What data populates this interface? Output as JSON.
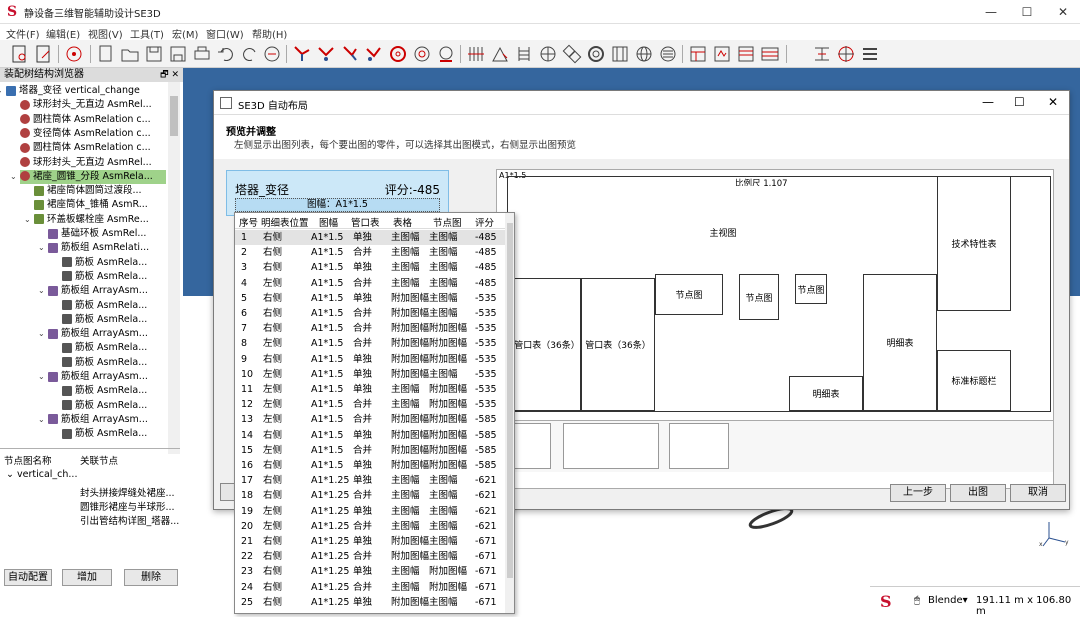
{
  "app": {
    "title": "静设备三维智能辅助设计SE3D"
  },
  "menu": [
    "文件(F)",
    "编辑(E)",
    "视图(V)",
    "工具(T)",
    "宏(M)",
    "窗口(W)",
    "帮助(H)"
  ],
  "tree_panel": {
    "title": "装配树结构浏览器",
    "items": [
      {
        "label": "塔器_变径 vertical_change",
        "level": 0
      },
      {
        "label": "球形封头_无直边 AsmRel...",
        "level": 1
      },
      {
        "label": "圆柱筒体 AsmRelation c...",
        "level": 1
      },
      {
        "label": "变径筒体 AsmRelation c...",
        "level": 1
      },
      {
        "label": "圆柱筒体 AsmRelation c...",
        "level": 1
      },
      {
        "label": "球形封头_无直边 AsmRel...",
        "level": 1
      },
      {
        "label": "裙座_圆锥_分段 AsmRela...",
        "level": 1
      },
      {
        "label": "裙座筒体圆筒过渡段...",
        "level": 2
      },
      {
        "label": "裙座筒体_锥桶 AsmR...",
        "level": 2
      },
      {
        "label": "环盖板螺栓座 AsmRe...",
        "level": 2
      },
      {
        "label": "基础环板 AsmRel...",
        "level": 3
      },
      {
        "label": "筋板组 AsmRelati...",
        "level": 3
      },
      {
        "label": "筋板 AsmRela...",
        "level": 4
      },
      {
        "label": "筋板 AsmRela...",
        "level": 4
      },
      {
        "label": "筋板组 ArrayAsm...",
        "level": 3
      },
      {
        "label": "筋板 AsmRela...",
        "level": 4
      },
      {
        "label": "筋板 AsmRela...",
        "level": 4
      },
      {
        "label": "筋板组 ArrayAsm...",
        "level": 3
      },
      {
        "label": "筋板 AsmRela...",
        "level": 4
      },
      {
        "label": "筋板 AsmRela...",
        "level": 4
      },
      {
        "label": "筋板组 ArrayAsm...",
        "level": 3
      },
      {
        "label": "筋板 AsmRela...",
        "level": 4
      },
      {
        "label": "筋板 AsmRela...",
        "level": 4
      },
      {
        "label": "筋板组 ArrayAsm...",
        "level": 3
      },
      {
        "label": "筋板 AsmRela...",
        "level": 4
      }
    ]
  },
  "node_panel": {
    "col1": "节点图名称",
    "col2": "关联节点",
    "root": "vertical_ch...",
    "children": [
      "封头拼接焊缝处裙座...",
      "圆锥形裙座与半球形...",
      "引出管结构详图_塔器..."
    ],
    "buttons": [
      "自动配置",
      "增加",
      "删除"
    ]
  },
  "dialog": {
    "title": "SE3D 自动布局",
    "heading": "预览并调整",
    "subtext": "左侧显示出图列表，每个要出图的零件，可以选择其出图模式，右侧显示出图预览",
    "card": {
      "name": "塔器_变径",
      "score": "评分:-485",
      "sheet": "图幅：A1*1.5"
    },
    "buttons": {
      "prev": "上一步",
      "output": "出图",
      "cancel": "取消"
    },
    "preview": {
      "corner": "A1*1.5",
      "scale": "比例尺 1.107",
      "main_view": "主视图",
      "tech": "技术特性表",
      "pipe1": "管口表（36条）",
      "pipe2": "管口表（36条）",
      "node1": "节点图",
      "node2": "节点图",
      "node3": "节点图",
      "detail1": "明细表",
      "detail2": "明细表",
      "title_block": "标准标题栏"
    }
  },
  "table": {
    "headers": [
      "序号",
      "明细表位置",
      "图幅",
      "管口表",
      "表格",
      "节点图",
      "评分"
    ],
    "rows": [
      [
        "1",
        "右侧",
        "A1*1.5",
        "单独",
        "主图幅",
        "主图幅",
        "-485"
      ],
      [
        "2",
        "右侧",
        "A1*1.5",
        "合并",
        "主图幅",
        "主图幅",
        "-485"
      ],
      [
        "3",
        "右侧",
        "A1*1.5",
        "单独",
        "主图幅",
        "主图幅",
        "-485"
      ],
      [
        "4",
        "左侧",
        "A1*1.5",
        "合并",
        "主图幅",
        "主图幅",
        "-485"
      ],
      [
        "5",
        "右侧",
        "A1*1.5",
        "单独",
        "附加图幅",
        "主图幅",
        "-535"
      ],
      [
        "6",
        "右侧",
        "A1*1.5",
        "合并",
        "附加图幅",
        "主图幅",
        "-535"
      ],
      [
        "7",
        "右侧",
        "A1*1.5",
        "合并",
        "附加图幅",
        "附加图幅",
        "-535"
      ],
      [
        "8",
        "左侧",
        "A1*1.5",
        "合并",
        "附加图幅",
        "附加图幅",
        "-535"
      ],
      [
        "9",
        "右侧",
        "A1*1.5",
        "单独",
        "附加图幅",
        "附加图幅",
        "-535"
      ],
      [
        "10",
        "左侧",
        "A1*1.5",
        "单独",
        "附加图幅",
        "主图幅",
        "-535"
      ],
      [
        "11",
        "左侧",
        "A1*1.5",
        "单独",
        "主图幅",
        "附加图幅",
        "-535"
      ],
      [
        "12",
        "左侧",
        "A1*1.5",
        "合并",
        "主图幅",
        "附加图幅",
        "-535"
      ],
      [
        "13",
        "左侧",
        "A1*1.5",
        "合并",
        "附加图幅",
        "附加图幅",
        "-585"
      ],
      [
        "14",
        "右侧",
        "A1*1.5",
        "单独",
        "附加图幅",
        "附加图幅",
        "-585"
      ],
      [
        "15",
        "左侧",
        "A1*1.5",
        "合并",
        "附加图幅",
        "附加图幅",
        "-585"
      ],
      [
        "16",
        "右侧",
        "A1*1.5",
        "单独",
        "附加图幅",
        "附加图幅",
        "-585"
      ],
      [
        "17",
        "右侧",
        "A1*1.25",
        "单独",
        "主图幅",
        "主图幅",
        "-621"
      ],
      [
        "18",
        "右侧",
        "A1*1.25",
        "合并",
        "主图幅",
        "主图幅",
        "-621"
      ],
      [
        "19",
        "左侧",
        "A1*1.25",
        "单独",
        "主图幅",
        "主图幅",
        "-621"
      ],
      [
        "20",
        "左侧",
        "A1*1.25",
        "合并",
        "主图幅",
        "主图幅",
        "-621"
      ],
      [
        "21",
        "右侧",
        "A1*1.25",
        "单独",
        "附加图幅",
        "主图幅",
        "-671"
      ],
      [
        "22",
        "右侧",
        "A1*1.25",
        "合并",
        "附加图幅",
        "主图幅",
        "-671"
      ],
      [
        "23",
        "右侧",
        "A1*1.25",
        "单独",
        "主图幅",
        "附加图幅",
        "-671"
      ],
      [
        "24",
        "右侧",
        "A1*1.25",
        "合并",
        "主图幅",
        "附加图幅",
        "-671"
      ],
      [
        "25",
        "右侧",
        "A1*1.25",
        "单独",
        "附加图幅",
        "主图幅",
        "-671"
      ]
    ]
  },
  "status": {
    "renderer": "Blende▾",
    "dims": "191.11 m x 106.80 m"
  }
}
